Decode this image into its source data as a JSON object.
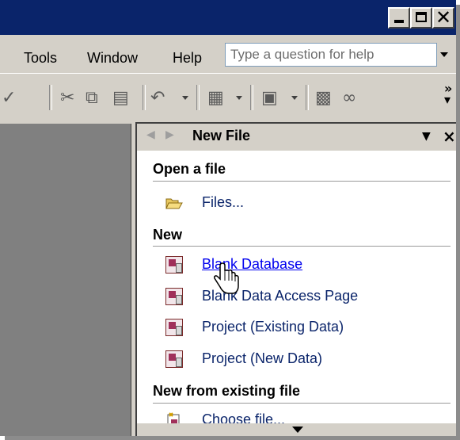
{
  "menubar": {
    "items": [
      {
        "label": "Tools"
      },
      {
        "label": "Window"
      },
      {
        "label": "Help"
      }
    ],
    "search_placeholder": "Type a question for help"
  },
  "toolbar": {
    "icons": [
      "spellcheck-icon",
      "cut-icon",
      "copy-icon",
      "paste-icon",
      "undo-icon",
      "office-links-icon",
      "analyze-icon",
      "properties-icon",
      "relationships-icon"
    ]
  },
  "task_pane": {
    "title": "New File",
    "sections": [
      {
        "heading": "Open a file",
        "items": [
          {
            "label": "Files...",
            "icon": "open-folder-icon"
          }
        ]
      },
      {
        "heading": "New",
        "items": [
          {
            "label": "Blank Database",
            "icon": "blank-database-icon"
          },
          {
            "label": "Blank Data Access Page",
            "icon": "data-access-page-icon"
          },
          {
            "label": "Project (Existing Data)",
            "icon": "project-existing-icon"
          },
          {
            "label": "Project (New Data)",
            "icon": "project-new-icon"
          }
        ]
      },
      {
        "heading": "New from existing file",
        "items": [
          {
            "label": "Choose file...",
            "icon": "choose-file-icon"
          }
        ]
      }
    ]
  },
  "colors": {
    "title_bar": "#0a246a",
    "chrome": "#d4d0c8",
    "link": "#0a246a",
    "workspace": "#808080"
  }
}
